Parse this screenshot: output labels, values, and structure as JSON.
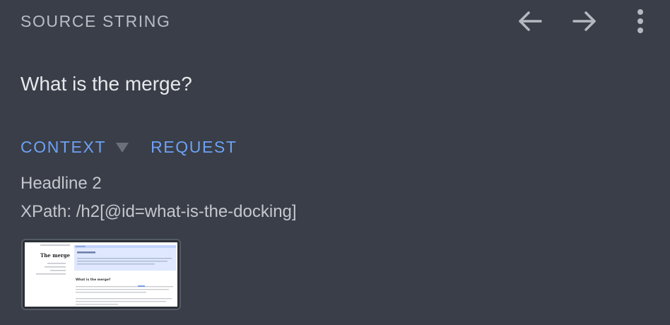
{
  "header": {
    "title": "SOURCE STRING",
    "icons": {
      "prev": "arrow-left-icon",
      "next": "arrow-right-icon",
      "more": "more-vertical-icon"
    }
  },
  "source": {
    "text": "What is the merge?"
  },
  "tabs": [
    {
      "label": "CONTEXT",
      "active": true,
      "has_dropdown": true
    },
    {
      "label": "REQUEST",
      "active": false
    }
  ],
  "context": {
    "type": "Headline 2",
    "xpath": "XPath: /h2[@id=what-is-the-docking]"
  },
  "screenshot": {
    "title": "The merge",
    "heading": "What is the merge?"
  },
  "colors": {
    "background": "#393e48",
    "accent": "#6ea1f4",
    "muted_text": "#b9bdc4",
    "primary_text": "#e6e8eb"
  }
}
